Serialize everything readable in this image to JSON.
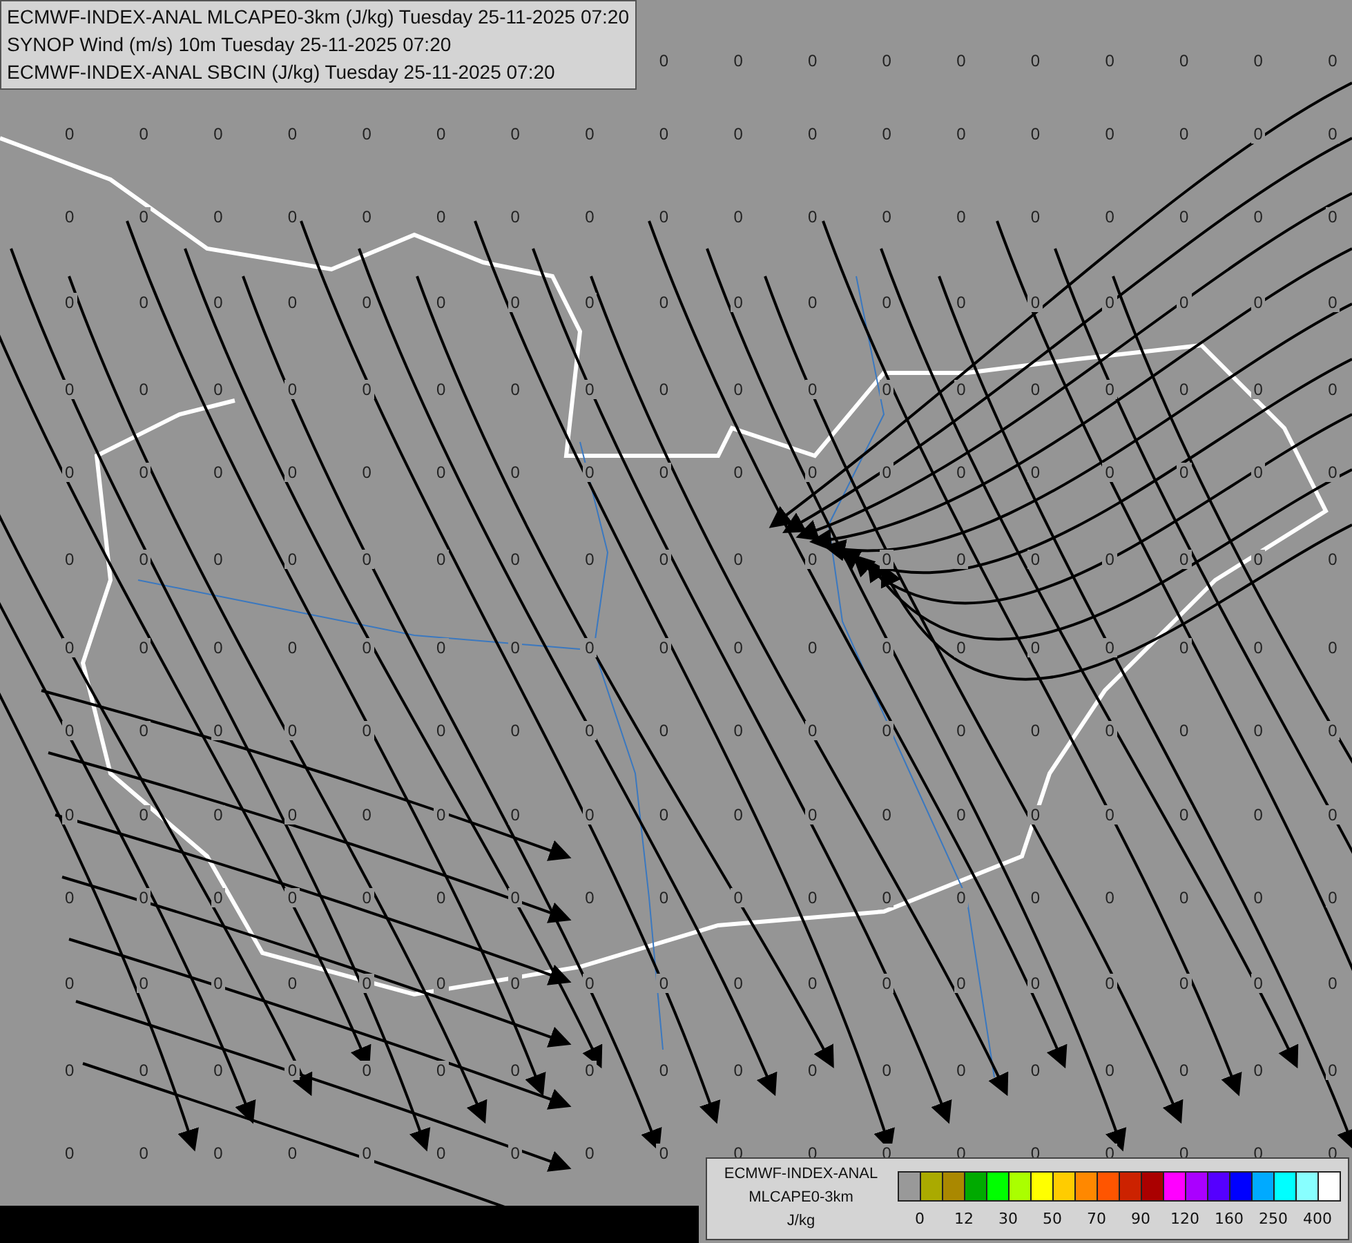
{
  "header": {
    "lines": [
      "ECMWF-INDEX-ANAL MLCAPE0-3km (J/kg) Tuesday 25-11-2025 07:20",
      "SYNOP Wind (m/s) 10m Tuesday 25-11-2025 07:20",
      "ECMWF-INDEX-ANAL SBCIN (J/kg) Tuesday 25-11-2025 07:20"
    ]
  },
  "grid_values": [
    [
      "0",
      "0",
      "0",
      "0",
      "0",
      "0",
      "0",
      "0",
      "0",
      "0"
    ],
    [
      "0",
      "0",
      "0",
      "0",
      "0",
      "0",
      "0",
      "0",
      "0",
      "0",
      "0",
      "0",
      "0",
      "0",
      "0",
      "0",
      "0",
      "0"
    ],
    [
      "0",
      "0",
      "0",
      "0",
      "0",
      "0",
      "0",
      "0",
      "0",
      "0",
      "0",
      "0",
      "0",
      "0",
      "0",
      "0",
      "0",
      "0"
    ],
    [
      "0",
      "0",
      "0",
      "0",
      "0",
      "0",
      "0",
      "0",
      "0",
      "0",
      "0",
      "0",
      "0",
      "0",
      "0",
      "0",
      "0",
      "0"
    ],
    [
      "0",
      "0",
      "0",
      "0",
      "0",
      "0",
      "0",
      "0",
      "0",
      "0",
      "0",
      "0",
      "0",
      "0",
      "0",
      "0",
      "0",
      "0"
    ],
    [
      "0",
      "0",
      "0",
      "0",
      "0",
      "0",
      "0",
      "0",
      "0",
      "0",
      "0",
      "0",
      "0",
      "0",
      "0",
      "0",
      "0",
      "0"
    ],
    [
      "0",
      "0",
      "0",
      "0",
      "0",
      "0",
      "0",
      "0",
      "0",
      "0",
      "0",
      "0",
      "0",
      "0",
      "0",
      "0",
      "0",
      "0"
    ],
    [
      "0",
      "0",
      "0",
      "0",
      "0",
      "0",
      "0",
      "0",
      "0",
      "0",
      "0",
      "0",
      "0",
      "0",
      "0",
      "0",
      "0",
      "0"
    ],
    [
      "0",
      "0",
      "0",
      "0",
      "0",
      "0",
      "0",
      "0",
      "0",
      "0",
      "0",
      "0",
      "0",
      "0",
      "0",
      "0",
      "0",
      "0"
    ],
    [
      "0",
      "0",
      "0",
      "0",
      "0",
      "0",
      "0",
      "0",
      "0",
      "0",
      "0",
      "0",
      "0",
      "0",
      "0",
      "0",
      "0",
      "0"
    ],
    [
      "0",
      "0",
      "0",
      "0",
      "0",
      "0",
      "0",
      "0",
      "0",
      "0",
      "0",
      "0",
      "0",
      "0",
      "0",
      "0",
      "0",
      "0"
    ],
    [
      "0",
      "0",
      "0",
      "0",
      "0",
      "0",
      "0",
      "0",
      "0",
      "0",
      "0",
      "0",
      "0",
      "0",
      "0",
      "0",
      "0",
      "0"
    ],
    [
      "0",
      "0",
      "0",
      "0",
      "0",
      "0",
      "0",
      "0",
      "0",
      "0",
      "0",
      "0",
      "0",
      "0",
      "0",
      "0",
      "0",
      "0"
    ],
    [
      "0",
      "0",
      "0",
      "0",
      "0",
      "0",
      "0",
      "0",
      "0",
      "0",
      "0",
      "0",
      "0",
      "0",
      "0",
      "0",
      "0",
      "0"
    ]
  ],
  "legend": {
    "lines": [
      "ECMWF-INDEX-ANAL",
      "MLCAPE0-3km",
      "J/kg"
    ],
    "bins": [
      {
        "color": "#999999"
      },
      {
        "color": "#aaaa00"
      },
      {
        "color": "#aa8800"
      },
      {
        "color": "#00aa00"
      },
      {
        "color": "#00ff00"
      },
      {
        "color": "#aaff00"
      },
      {
        "color": "#ffff00"
      },
      {
        "color": "#ffcc00"
      },
      {
        "color": "#ff8800"
      },
      {
        "color": "#ff5500"
      },
      {
        "color": "#cc2200"
      },
      {
        "color": "#aa0000"
      },
      {
        "color": "#ff00ff"
      },
      {
        "color": "#aa00ff"
      },
      {
        "color": "#5500ff"
      },
      {
        "color": "#0000ff"
      },
      {
        "color": "#00aaff"
      },
      {
        "color": "#00ffff"
      },
      {
        "color": "#88ffff"
      },
      {
        "color": "#ffffff"
      }
    ],
    "ticks": [
      "0",
      "12",
      "30",
      "50",
      "70",
      "90",
      "120",
      "160",
      "250",
      "400"
    ]
  }
}
